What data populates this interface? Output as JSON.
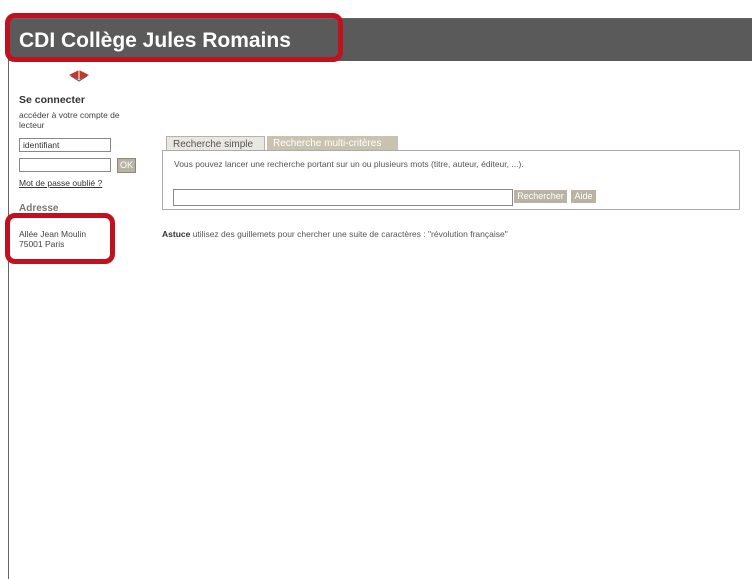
{
  "header": {
    "title": "CDI Collège Jules Romains"
  },
  "login": {
    "title": "Se connecter",
    "subtitle": "accéder à votre compte de lecteur",
    "username_value": "identifiant",
    "password_value": "",
    "ok_label": "OK",
    "forgot_label": "Mot de passe oublié ?"
  },
  "address": {
    "title": "Adresse",
    "line1": "Allée Jean Moulin",
    "line2": "75001 Paris"
  },
  "tabs": [
    {
      "label": "Recherche simple",
      "active": true
    },
    {
      "label": "Recherche multi-critères",
      "active": false
    }
  ],
  "search": {
    "info": "Vous pouvez lancer une recherche portant sur un ou plusieurs mots (titre, auteur, éditeur, ...).",
    "value": "",
    "button_label": "Rechercher",
    "help_label": "Aide"
  },
  "tip": {
    "label": "Astuce",
    "text": " utilisez des guillemets pour chercher une suite de caractères : \"révolution française\""
  },
  "colors": {
    "header_bg": "#5a5a5a",
    "highlight": "#c1111e",
    "button_bg": "#b9b3a4"
  },
  "icons": {
    "logo": "book-icon"
  }
}
